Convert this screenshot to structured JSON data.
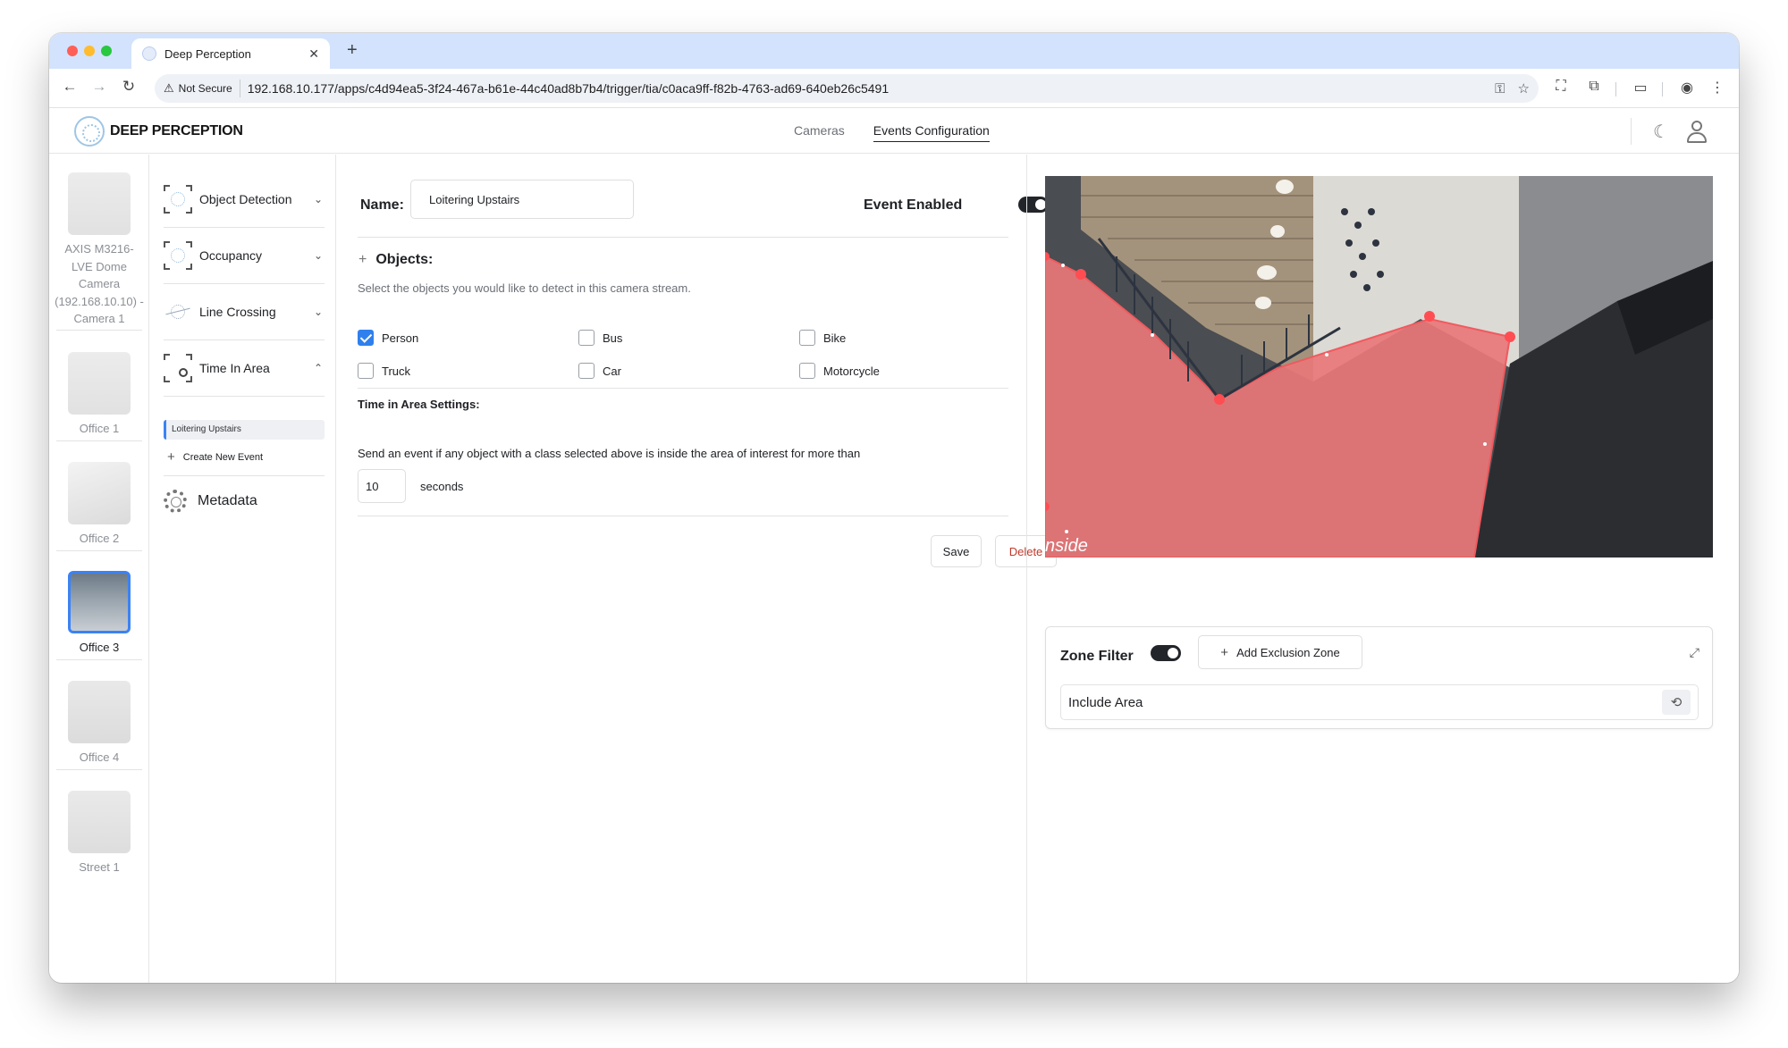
{
  "browser": {
    "tab_title": "Deep Perception",
    "new_tab_symbol": "+",
    "security_label": "Not Secure",
    "url": "192.168.10.177/apps/c4d94ea5-3f24-467a-b61e-44c40ad8b7b4/trigger/tia/c0aca9ff-f82b-4763-ad69-640eb26c5491"
  },
  "app": {
    "brand": "DEEP PERCEPTION",
    "nav": [
      {
        "label": "Cameras",
        "active": false
      },
      {
        "label": "Events Configuration",
        "active": true
      }
    ]
  },
  "cameras": [
    {
      "label": "AXIS M3216-LVE Dome Camera (192.168.10.10) - Camera 1",
      "active": false
    },
    {
      "label": "Office 1",
      "active": false
    },
    {
      "label": "Office 2",
      "active": false
    },
    {
      "label": "Office 3",
      "active": true
    },
    {
      "label": "Office 4",
      "active": false
    },
    {
      "label": "Street 1",
      "active": false
    }
  ],
  "event_menu": {
    "items": [
      {
        "label": "Object Detection",
        "chevron": "⌄"
      },
      {
        "label": "Occupancy",
        "chevron": "⌄"
      },
      {
        "label": "Line Crossing",
        "chevron": "⌄"
      },
      {
        "label": "Time In Area",
        "chevron": "⌃"
      }
    ],
    "sub_event": "Loitering Upstairs",
    "create_new": "Create New Event",
    "metadata": "Metadata"
  },
  "form": {
    "name_label": "Name:",
    "name_value": "Loitering Upstairs",
    "event_enabled_label": "Event Enabled",
    "event_enabled": true,
    "objects_title": "Objects:",
    "objects_subtitle": "Select the objects you would like to detect in this camera stream.",
    "objects": [
      {
        "label": "Person",
        "checked": true
      },
      {
        "label": "Bus",
        "checked": false
      },
      {
        "label": "Bike",
        "checked": false
      },
      {
        "label": "Truck",
        "checked": false
      },
      {
        "label": "Car",
        "checked": false
      },
      {
        "label": "Motorcycle",
        "checked": false
      }
    ],
    "tia_title": "Time in Area Settings:",
    "tia_description": "Send an event if any object with a class selected above is inside the area of interest for more than",
    "seconds_value": "10",
    "seconds_label": "seconds",
    "save_label": "Save",
    "delete_label": "Delete"
  },
  "preview": {
    "overlay_text": "nside",
    "zone_color": "#e8777a"
  },
  "zone_filter": {
    "label": "Zone Filter",
    "enabled": true,
    "add_label": "Add Exclusion Zone",
    "include_label": "Include Area"
  },
  "colors": {
    "accent": "#2f80ed",
    "delete": "#c0392b",
    "tab_bar": "#d3e3fd"
  }
}
